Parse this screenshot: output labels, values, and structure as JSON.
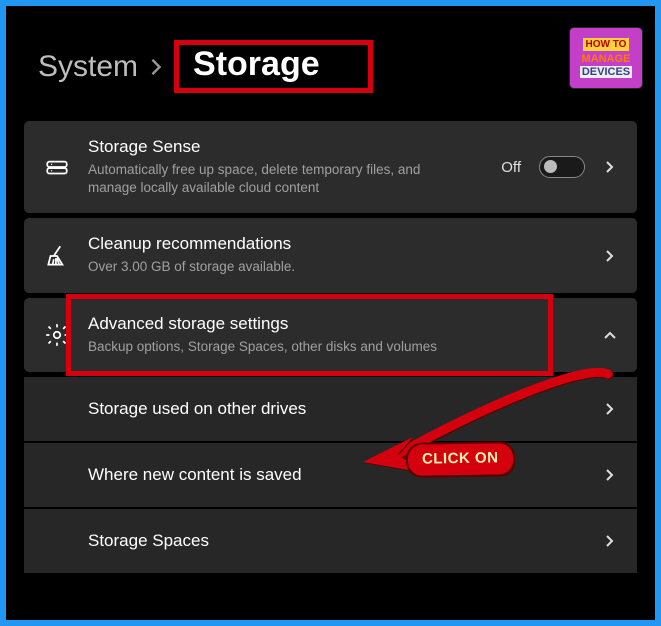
{
  "breadcrumb": {
    "parent": "System",
    "current": "Storage"
  },
  "logo": {
    "line1": "HOW TO",
    "line2": "MANAGE",
    "line3": "DEVICES"
  },
  "cards": {
    "storageSense": {
      "title": "Storage Sense",
      "desc": "Automatically free up space, delete temporary files, and manage locally available cloud content",
      "toggleLabel": "Off"
    },
    "cleanup": {
      "title": "Cleanup recommendations",
      "desc": "Over 3.00 GB of storage available."
    },
    "advanced": {
      "title": "Advanced storage settings",
      "desc": "Backup options, Storage Spaces, other disks and volumes"
    },
    "sub1": {
      "title": "Storage used on other drives"
    },
    "sub2": {
      "title": "Where new content is saved"
    },
    "sub3": {
      "title": "Storage Spaces"
    }
  },
  "annotation": {
    "clickOn": "CLICK ON"
  }
}
